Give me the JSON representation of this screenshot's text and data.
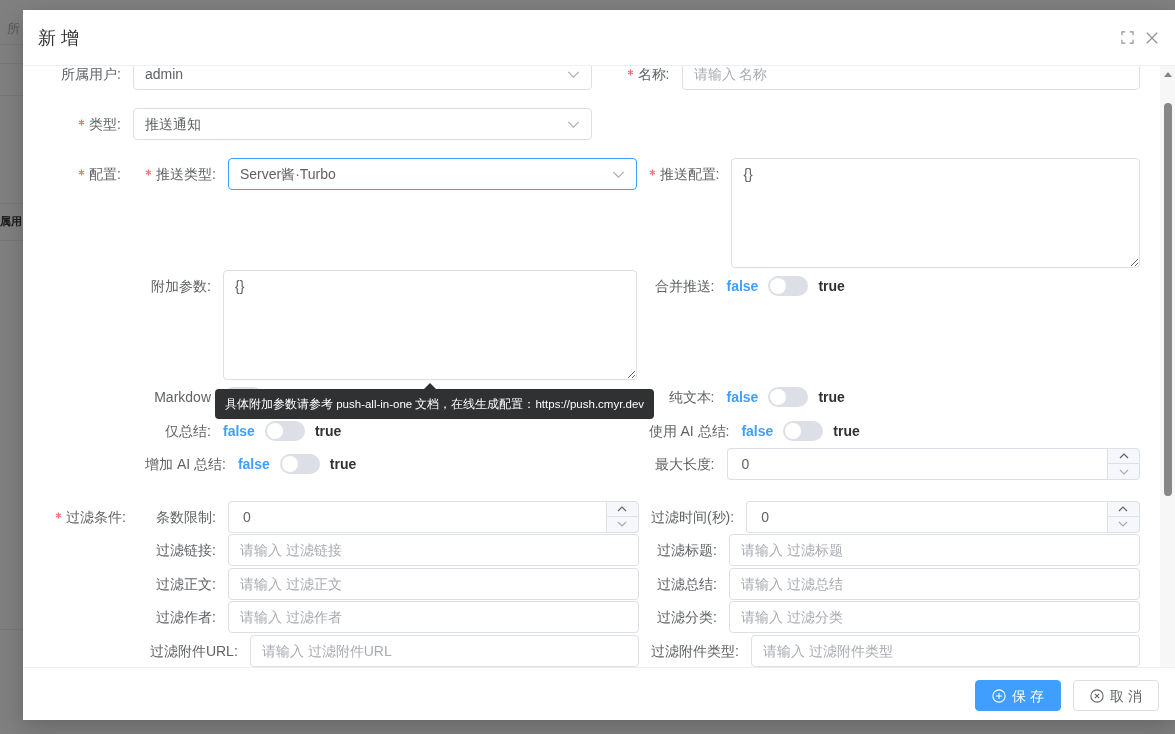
{
  "background_page": {
    "field_text": "所",
    "column_header": "属用"
  },
  "dialog": {
    "title": "新 增"
  },
  "form": {
    "items": [
      {
        "kind": "select",
        "label": "所属用户:",
        "required": false,
        "value": "admin",
        "focused": false
      },
      {
        "kind": "input",
        "label": "名称:",
        "required": true,
        "placeholder": "请输入 名称"
      },
      {
        "kind": "select",
        "label": "类型:",
        "required": true,
        "value": "推送通知",
        "focused": false
      },
      {
        "kind": "group",
        "label": "配置:",
        "required": true,
        "fields": [
          {
            "kind": "select",
            "label": "推送类型:",
            "required": true,
            "value": "Server酱·Turbo",
            "focused": true
          },
          {
            "kind": "textarea",
            "label": "推送配置:",
            "required": true,
            "value": "{}"
          },
          {
            "kind": "textarea",
            "label": "附加参数:",
            "required": false,
            "value": "{}",
            "tooltip": "具体附加参数请参考 push-all-in-one 文档，在线生成配置：https://push.cmyr.dev"
          },
          {
            "kind": "switch",
            "label": "合并推送:",
            "required": false,
            "on": false,
            "off_label": "false",
            "on_label": "true"
          },
          {
            "kind": "switch",
            "label": "Markdow",
            "required": false,
            "on": false
          },
          {
            "kind": "switch",
            "label": "纯文本:",
            "required": false,
            "on": false,
            "off_label": "false",
            "on_label": "true"
          },
          {
            "kind": "switch",
            "label": "仅总结:",
            "required": false,
            "on": false,
            "off_label": "false",
            "on_label": "true"
          },
          {
            "kind": "switch",
            "label": "使用 AI 总结:",
            "required": false,
            "on": false,
            "off_label": "false",
            "on_label": "true"
          },
          {
            "kind": "switch",
            "label": "增加 AI 总结:",
            "required": false,
            "on": false,
            "off_label": "false",
            "on_label": "true"
          },
          {
            "kind": "number",
            "label": "最大长度:",
            "required": false,
            "value": "0",
            "decrease_disabled": true
          }
        ]
      },
      {
        "kind": "group",
        "label": "过滤条件:",
        "required": true,
        "fields": [
          {
            "kind": "number",
            "label": "条数限制:",
            "required": false,
            "value": "0",
            "decrease_disabled": true
          },
          {
            "kind": "number",
            "label": "过滤时间(秒):",
            "required": false,
            "value": "0",
            "decrease_disabled": true
          },
          {
            "kind": "input",
            "label": "过滤链接:",
            "required": false,
            "placeholder": "请输入 过滤链接"
          },
          {
            "kind": "input",
            "label": "过滤标题:",
            "required": false,
            "placeholder": "请输入 过滤标题"
          },
          {
            "kind": "input",
            "label": "过滤正文:",
            "required": false,
            "placeholder": "请输入 过滤正文"
          },
          {
            "kind": "input",
            "label": "过滤总结:",
            "required": false,
            "placeholder": "请输入 过滤总结"
          },
          {
            "kind": "input",
            "label": "过滤作者:",
            "required": false,
            "placeholder": "请输入 过滤作者"
          },
          {
            "kind": "input",
            "label": "过滤分类:",
            "required": false,
            "placeholder": "请输入 过滤分类"
          },
          {
            "kind": "input",
            "label": "过滤附件URL:",
            "required": false,
            "placeholder": "请输入 过滤附件URL"
          },
          {
            "kind": "input",
            "label": "过滤附件类型:",
            "required": false,
            "placeholder": "请输入 过滤附件类型"
          }
        ]
      }
    ]
  },
  "footer": {
    "buttons": [
      {
        "kind": "primary",
        "label": "保 存"
      },
      {
        "kind": "default",
        "label": "取 消"
      }
    ]
  }
}
